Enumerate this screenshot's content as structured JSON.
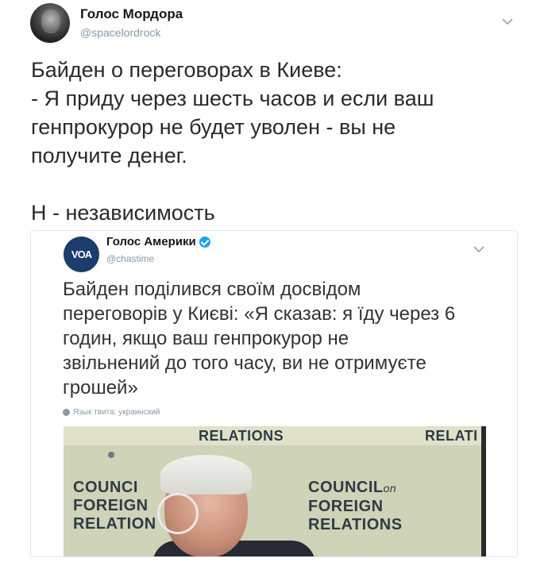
{
  "tweet": {
    "display_name": "Голос Мордора",
    "handle": "@spacelordrock",
    "text": "Байден о переговорах в Киеве:\n- Я приду через шесть часов и если ваш\nгенпрокурор не будет уволен - вы не\nполучите денег.\n\nН - независимость"
  },
  "quoted_tweet": {
    "display_name": "Голос Америки",
    "avatar_label": "VOA",
    "handle": "@chastime",
    "text": "Байден поділився своїм досвідом\nпереговорів у Києві: «Я сказав: я їду через 6\nгодин, якщо ваш генпрокурор не\nзвільнений до того часу, ви не отримуєте\nгрошей»",
    "language_note": "Язык твита: украинский",
    "verified": true
  },
  "video": {
    "banner_text_1": "RELATIONS",
    "banner_text_2": "RELATI",
    "sign_left": "COUNCI\nFOREIGN\nRELATION",
    "sign_right_line1": "COUNCIL",
    "sign_right_on": "on",
    "sign_right_rest": "FOREIGN\nRELATIONS"
  },
  "icons": {
    "caret": "chevron-down-icon",
    "verified": "verified-badge-icon",
    "globe": "globe-icon"
  },
  "colors": {
    "text": "#14171a",
    "secondary": "#8899a6",
    "verified": "#1da1f2",
    "border": "#e1e8ed"
  }
}
